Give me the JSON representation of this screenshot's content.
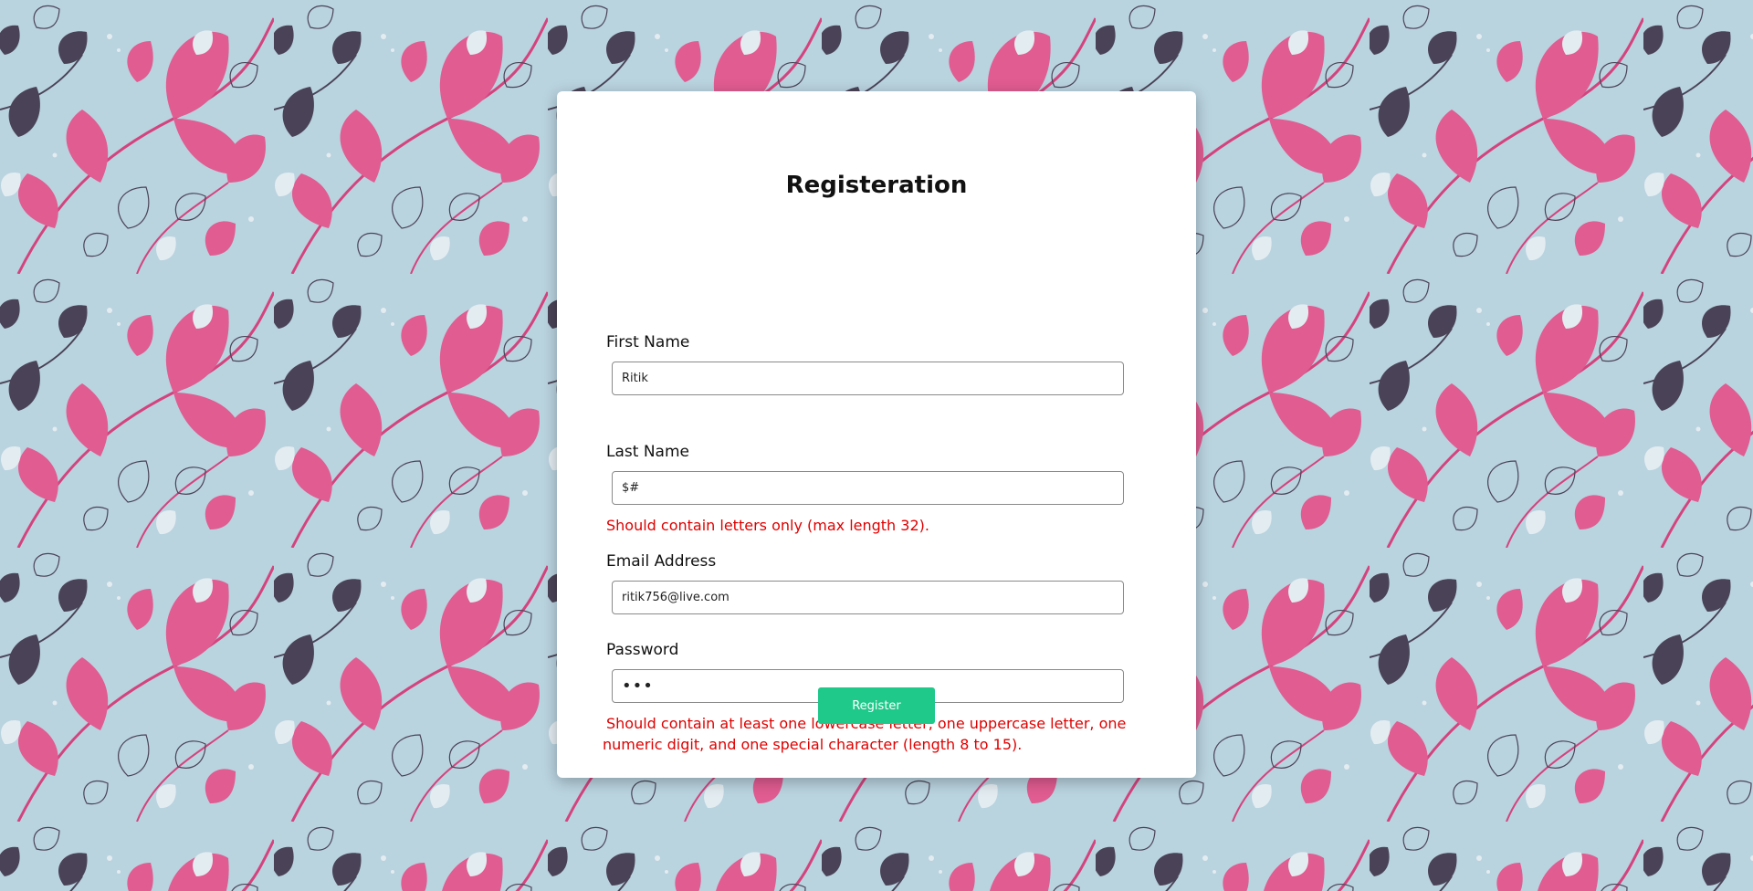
{
  "theme": {
    "background": "#b9d3df",
    "leaf_pink": "#e05c91",
    "leaf_dark": "#4a4357",
    "leaf_light": "#e3ecf1",
    "error_color": "#e00000",
    "button_color": "#1ec98a"
  },
  "form": {
    "title": "Registeration",
    "fields": {
      "first_name": {
        "label": "First Name",
        "value": "Ritik"
      },
      "last_name": {
        "label": "Last Name",
        "value": "$#"
      },
      "email": {
        "label": "Email Address",
        "value": "ritik756@live.com"
      },
      "password": {
        "label": "Password",
        "value": "abc"
      }
    },
    "errors": {
      "last_name": "Should contain letters only (max length 32).",
      "password": "Should contain at least one lowercase letter, one uppercase letter, one numeric digit, and one special character (length 8 to 15)."
    },
    "submit_label": "Register"
  }
}
